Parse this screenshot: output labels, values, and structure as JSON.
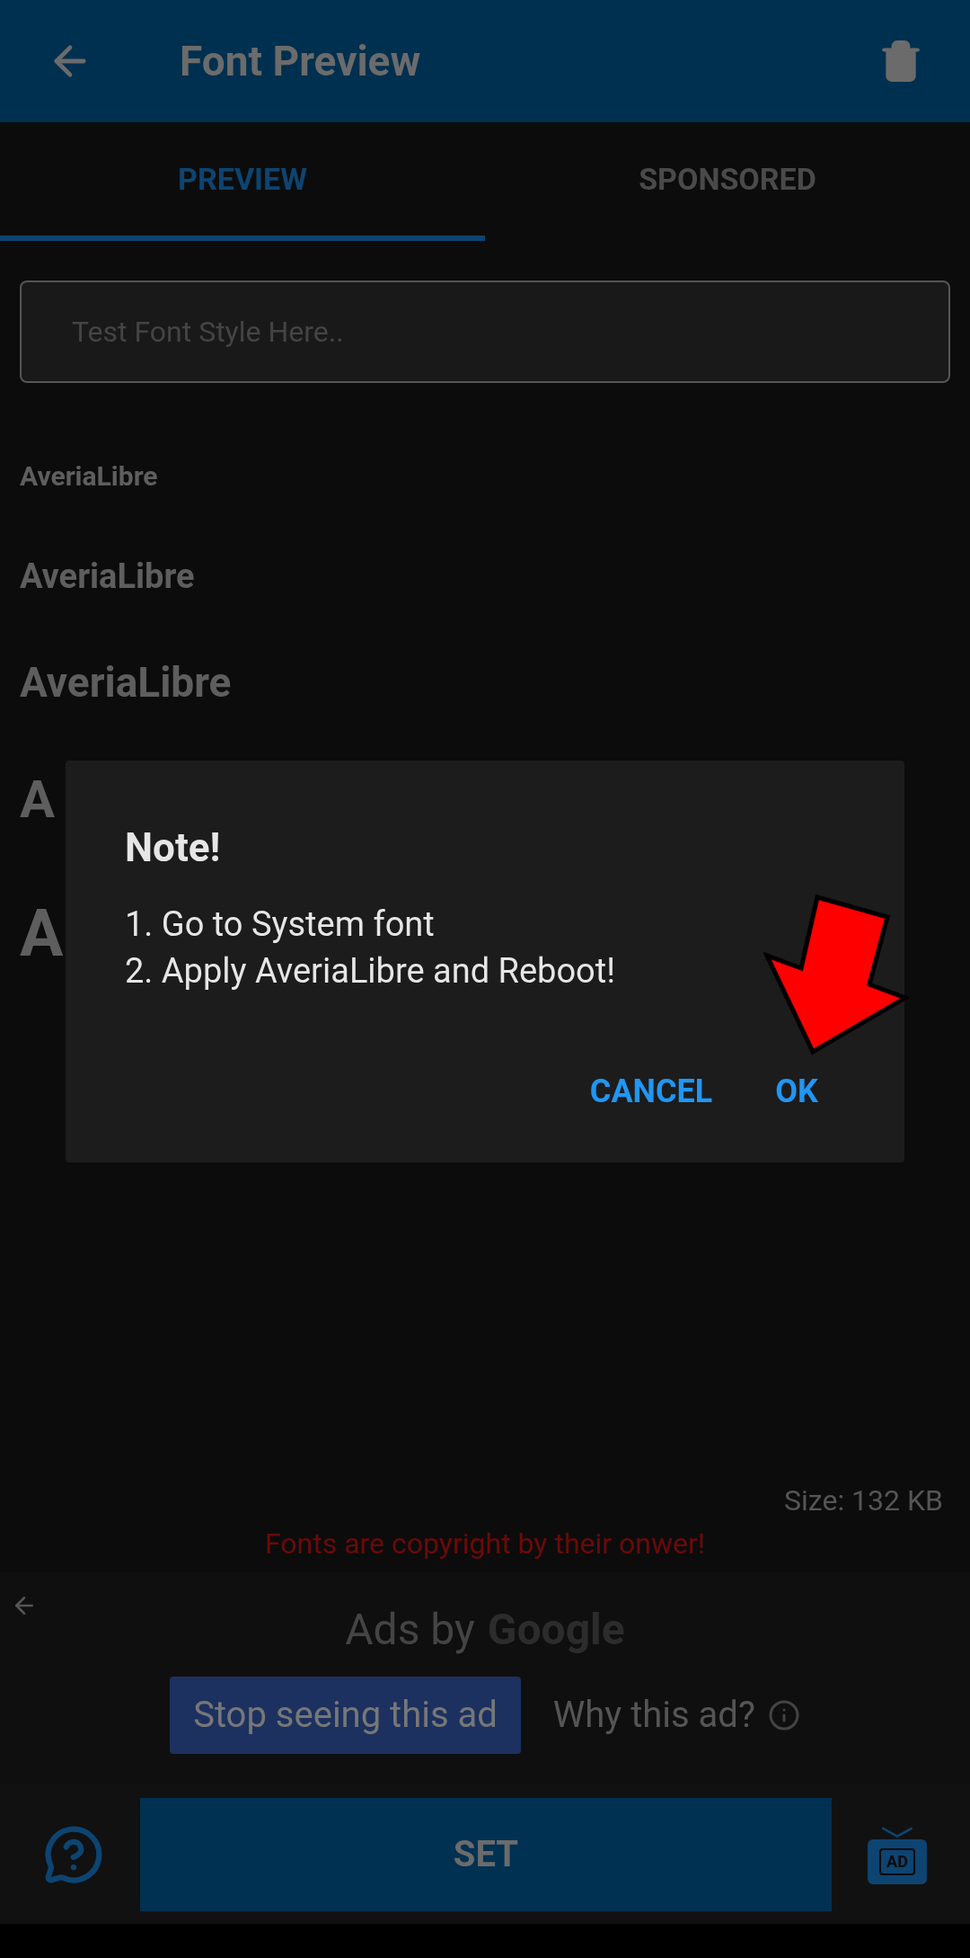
{
  "app_bar": {
    "title": "Font Preview"
  },
  "tabs": [
    {
      "label": "PREVIEW",
      "selected": true
    },
    {
      "label": "SPONSORED",
      "selected": false
    }
  ],
  "test_field": {
    "placeholder": "Test Font Style Here.."
  },
  "previews": [
    "AveriaLibre",
    "AveriaLibre",
    "AveriaLibre",
    "A",
    "A"
  ],
  "dialog": {
    "title": "Note!",
    "lines": [
      "1. Go to System font",
      "2. Apply AveriaLibre and Reboot!"
    ],
    "buttons": [
      "CANCEL",
      "OK"
    ]
  },
  "size": "Size: 132 KB",
  "copyright": "Fonts are copyright by their onwer!",
  "ad": {
    "ads_by": "Ads by",
    "brand": "Google",
    "stop": "Stop seeing this ad",
    "why": "Why this ad?"
  },
  "bottom_bar": {
    "set": "SET",
    "ad_icon_label": "AD"
  }
}
